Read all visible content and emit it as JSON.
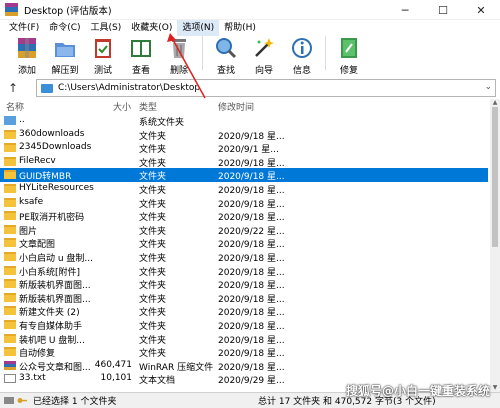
{
  "window": {
    "title": "Desktop (评估版本)",
    "controls": [
      "─",
      "☐",
      "✕"
    ]
  },
  "menu": [
    "文件(F)",
    "命令(C)",
    "工具(S)",
    "收藏夹(O)",
    "选项(N)",
    "帮助(H)"
  ],
  "toolbar": [
    {
      "label": "添加",
      "icon": "add-archive-icon"
    },
    {
      "label": "解压到",
      "icon": "extract-folder-icon"
    },
    {
      "label": "测试",
      "icon": "test-clipboard-icon"
    },
    {
      "label": "查看",
      "icon": "view-book-icon"
    },
    {
      "label": "删除",
      "icon": "delete-trash-icon"
    },
    {
      "label": "查找",
      "icon": "find-magnifier-icon"
    },
    {
      "label": "向导",
      "icon": "wizard-wand-icon"
    },
    {
      "label": "信息",
      "icon": "info-icon"
    },
    {
      "label": "修复",
      "icon": "repair-book-icon"
    }
  ],
  "address": {
    "path": "C:\\Users\\Administrator\\Desktop"
  },
  "columns": {
    "name": "名称",
    "size": "大小",
    "type": "类型",
    "modified": "修改时间"
  },
  "files": [
    {
      "name": "..",
      "size": "",
      "type": "系统文件夹",
      "date": "",
      "icon": "up"
    },
    {
      "name": "360downloads",
      "size": "",
      "type": "文件夹",
      "date": "2020/9/18 星...",
      "icon": "folder"
    },
    {
      "name": "2345Downloads",
      "size": "",
      "type": "文件夹",
      "date": "2020/9/1 星...",
      "icon": "folder"
    },
    {
      "name": "FileRecv",
      "size": "",
      "type": "文件夹",
      "date": "2020/9/18 星...",
      "icon": "folder"
    },
    {
      "name": "GUID转MBR",
      "size": "",
      "type": "文件夹",
      "date": "2020/9/18 星...",
      "icon": "folder",
      "selected": true
    },
    {
      "name": "HYLiteResources",
      "size": "",
      "type": "文件夹",
      "date": "2020/9/18 星...",
      "icon": "folder"
    },
    {
      "name": "ksafe",
      "size": "",
      "type": "文件夹",
      "date": "2020/9/18 星...",
      "icon": "folder"
    },
    {
      "name": "PE取消开机密码",
      "size": "",
      "type": "文件夹",
      "date": "2020/9/18 星...",
      "icon": "folder"
    },
    {
      "name": "图片",
      "size": "",
      "type": "文件夹",
      "date": "2020/9/22 星...",
      "icon": "folder"
    },
    {
      "name": "文章配图",
      "size": "",
      "type": "文件夹",
      "date": "2020/9/18 星...",
      "icon": "folder"
    },
    {
      "name": "小白启动 u 盘制...",
      "size": "",
      "type": "文件夹",
      "date": "2020/9/18 星...",
      "icon": "folder"
    },
    {
      "name": "小白系统[附件]",
      "size": "",
      "type": "文件夹",
      "date": "2020/9/18 星...",
      "icon": "folder"
    },
    {
      "name": "新版装机界面图...",
      "size": "",
      "type": "文件夹",
      "date": "2020/9/18 星...",
      "icon": "folder"
    },
    {
      "name": "新版装机界面图...",
      "size": "",
      "type": "文件夹",
      "date": "2020/9/18 星...",
      "icon": "folder"
    },
    {
      "name": "新建文件夹 (2)",
      "size": "",
      "type": "文件夹",
      "date": "2020/9/18 星...",
      "icon": "folder"
    },
    {
      "name": "有专自媒体助手",
      "size": "",
      "type": "文件夹",
      "date": "2020/9/18 星...",
      "icon": "folder"
    },
    {
      "name": "装机吧 U 盘制...",
      "size": "",
      "type": "文件夹",
      "date": "2020/9/18 星...",
      "icon": "folder"
    },
    {
      "name": "自动修复",
      "size": "",
      "type": "文件夹",
      "date": "2020/9/18 星...",
      "icon": "folder"
    },
    {
      "name": "公众号文章和图...",
      "size": "460,471",
      "type": "WinRAR 压缩文件",
      "date": "2020/9/18 星...",
      "icon": "rar"
    },
    {
      "name": "33.txt",
      "size": "10,101",
      "type": "文本文档",
      "date": "2020/9/29 星...",
      "icon": "txt"
    }
  ],
  "status": {
    "left": "已经选择 1 个文件夹",
    "right": "总计 17 文件夹 和 470,572 字节(3 个文件)"
  },
  "watermark": "搜狐号@小白一键重装系统"
}
